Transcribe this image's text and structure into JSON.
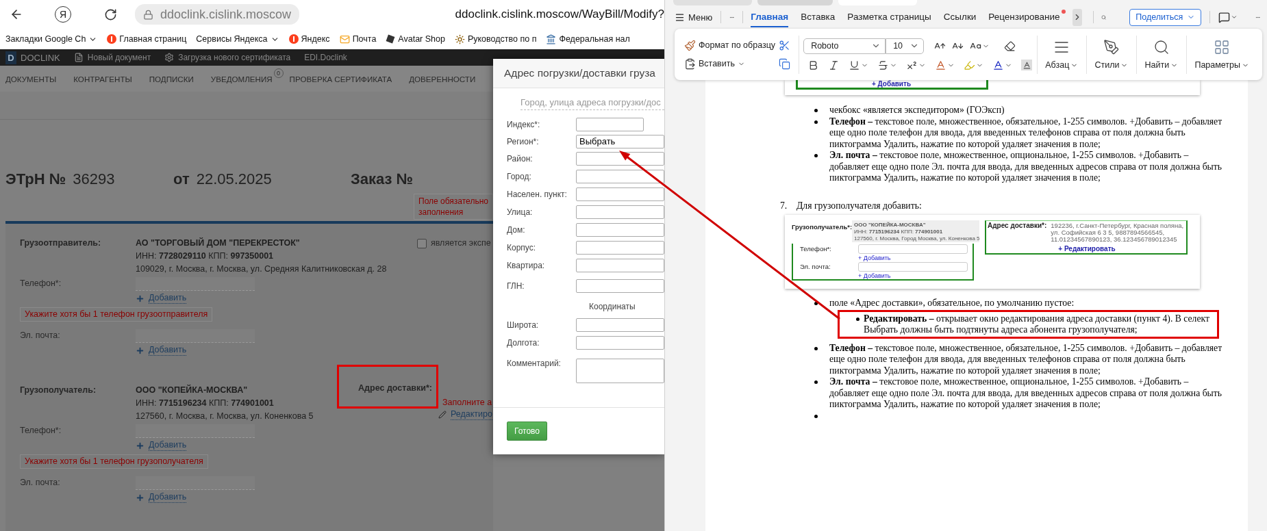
{
  "browser": {
    "home_glyph": "Я",
    "address": "ddoclink.cislink.moscow",
    "page_title": "ddoclink.cislink.moscow/WayBill/Modify?",
    "bookmarks": [
      {
        "kind": "folder",
        "label": "Закладки Google Ch"
      },
      {
        "kind": "yandex",
        "label": "Главная страниц"
      },
      {
        "kind": "folder",
        "label": "Сервисы Яндекса"
      },
      {
        "kind": "yandex",
        "label": "Яндекс"
      },
      {
        "kind": "mail",
        "label": "Почта"
      },
      {
        "kind": "shop",
        "label": "Avatar Shop"
      },
      {
        "kind": "guide",
        "label": "Руководство по п"
      },
      {
        "kind": "tax",
        "label": "Федеральная нал"
      }
    ]
  },
  "app": {
    "logo_letter": "D",
    "brand": "DOCLINK",
    "toolbar": [
      {
        "kind": "document",
        "label": "Новый документ"
      },
      {
        "kind": "gear",
        "label": "Загрузка нового сертификата"
      },
      {
        "kind": "plain",
        "label": "EDI.Doclink"
      }
    ],
    "nav": [
      {
        "label": "ДОКУМЕНТЫ"
      },
      {
        "label": "КОНТРАГЕНТЫ"
      },
      {
        "label": "ПОДПИСКИ"
      },
      {
        "label": "УВЕДОМЛЕНИЯ",
        "badge": "0"
      },
      {
        "label": "ПРОВЕРКА СЕРТИФИКАТА"
      },
      {
        "label": "ДОВЕРЕННОСТИ"
      }
    ]
  },
  "waybill": {
    "number_label": "ЭТрН №",
    "number": "36293",
    "date_label": "от",
    "date": "22.05.2025",
    "order_label": "Заказ №",
    "order_error": "Поле обязательно",
    "order_error_2": "заполнения"
  },
  "parties": [
    {
      "label": "Грузоотправитель:",
      "name": "АО \"ТОРГОВЫЙ ДОМ \"ПЕРЕКРЕСТОК\"",
      "details": "ИНН: **7728029110** КПП: **997350001**",
      "address": "109029, г. Москва, г. Москва, ул. Средняя Калитниковская д. 28",
      "side": {
        "kind": "checkbox",
        "label": "является экспе",
        "checked": false
      },
      "contacts": [
        {
          "label": "Телефон*:",
          "add": "Добавить",
          "error": "Укажите хотя бы 1 телефон грузоотправителя"
        },
        {
          "label": "Эл. почта:",
          "add": "Добавить"
        }
      ]
    },
    {
      "label": "Грузополучатель:",
      "name": "ООО \"КОПЕЙКА-МОСКВА\"",
      "details": "ИНН: **7715196234** КПП: **774901001**",
      "address": "127560, г. Москва, г. Москва, ул. Коненкова 5",
      "side": {
        "kind": "address",
        "label": "Адрес доставки*:",
        "highlighted": true,
        "error": "Заполните а",
        "link": "Редактиро"
      },
      "contacts": [
        {
          "label": "Телефон*:",
          "add": "Добавить",
          "error": "Укажите хотя бы 1 телефон грузополучателя"
        },
        {
          "label": "Эл. почта:",
          "add": "Добавить"
        }
      ]
    }
  ],
  "modal": {
    "title": "Адрес погрузки/доставки груза",
    "search_placeholder": "Город, улица адреса погрузки/дос",
    "fields": [
      {
        "kind": "short",
        "label": "Индекс*:"
      },
      {
        "kind": "select",
        "label": "Регион*:",
        "value": "Выбрать"
      },
      {
        "kind": "input",
        "label": "Район:"
      },
      {
        "kind": "input",
        "label": "Город:"
      },
      {
        "kind": "input",
        "label": "Населен. пункт:"
      },
      {
        "kind": "input",
        "label": "Улица:"
      },
      {
        "kind": "input",
        "label": "Дом:"
      },
      {
        "kind": "input",
        "label": "Корпус:"
      },
      {
        "kind": "input",
        "label": "Квартира:"
      },
      {
        "kind": "spaced",
        "label": "ГЛН:"
      },
      {
        "kind": "heading",
        "label": "Координаты"
      },
      {
        "kind": "input",
        "label": "Широта:"
      },
      {
        "kind": "input",
        "label": "Долгота:"
      },
      {
        "kind": "textarea",
        "label": "Комментарий:"
      }
    ],
    "button": "Готово"
  },
  "editor": {
    "menu": "Меню",
    "tabs": [
      {
        "label": "Главная",
        "selected": true,
        "notification": false
      },
      {
        "label": "Вставка",
        "selected": false,
        "notification": false
      },
      {
        "label": "Разметка страницы",
        "selected": false,
        "notification": false
      },
      {
        "label": "Ссылки",
        "selected": false,
        "notification": false
      },
      {
        "label": "Рецензирование",
        "selected": false,
        "notification": true
      }
    ],
    "share": "Поделиться",
    "ribbon": {
      "format_painter": "Формат по образцу",
      "paste": "Вставить",
      "font": "Roboto",
      "size": "10",
      "groups": [
        {
          "kind": "paragraph",
          "label": "Абзац"
        },
        {
          "kind": "styles",
          "label": "Стили"
        },
        {
          "kind": "find",
          "label": "Найти"
        },
        {
          "kind": "options",
          "label": "Параметры"
        }
      ]
    }
  },
  "document": {
    "top_figure": {
      "add": "+ Добавить"
    },
    "blocks": [
      {
        "kind": "bullet",
        "text": "чекбокс «является экспедитором» (ГОЭксп)"
      },
      {
        "kind": "bullet",
        "text": "**Телефон –** текстовое поле, множественное, обязательное, 1-255 символов. +Добавить – добавляет еще одно поле телефон для ввода, для введенных телефонов справа от поля должна быть пиктограмма Удалить, нажатие по которой удаляет значения в поле;"
      },
      {
        "kind": "bullet",
        "text": "**Эл. почта –** текстовое поле, множественное, опциональное, 1-255 символов. +Добавить – добавляет еще одно поле Эл. почта для ввода, для введенных адресов справа от поля должна быть пиктограмма Удалить, нажатие по которой удаляет значения в поле;"
      },
      {
        "kind": "numbered",
        "number": "7.",
        "text": "Для грузополучателя добавить:"
      },
      {
        "kind": "figure",
        "recipient_label": "Грузополучатель*:",
        "recipient_name": "ООО \"КОПЕЙКА-МОСКВА\"",
        "recipient_details": "ИНН: **7715196234** КПП: **774901001**",
        "recipient_address": "127560, г. Москва, Город Москва, ул. Коненкова 5",
        "contacts": [
          {
            "label": "Телефон*:",
            "add": "+ Добавить"
          },
          {
            "label": "Эл. почта:",
            "add": "+ Добавить"
          }
        ],
        "address_label": "Адрес доставки*:",
        "address_value": "192236, г.Санкт-Петербург, Красная поляна, ул. Софийская 6 3 5, 9887894566545, 11.01234567890123, 36.123456789012345",
        "edit_link": "+ Редактировать"
      },
      {
        "kind": "bullet",
        "text": "поле «Адрес доставки», обязательное, по умолчанию пустое:",
        "children": [
          {
            "text": "**Редактировать –** открывает окно редактирования адреса доставки (пункт 4). В селект Выбрать должны быть подтянуты адреса абонента грузополучателя;",
            "highlighted": true
          }
        ]
      },
      {
        "kind": "bullet",
        "text": "**Телефон –** текстовое поле, множественное, обязательное, 1-255 символов. +Добавить – добавляет еще одно поле телефон для ввода, для введенных телефонов справа от поля должна быть пиктограмма Удалить, нажатие по которой удаляет значения в поле;"
      },
      {
        "kind": "bullet",
        "text": "**Эл. почта –** текстовое поле, множественное, опциональное, 1-255 символов. +Добавить – добавляет еще одно поле Эл. почта для ввода, для введенных адресов справа от поля должна быть пиктограмма Удалить, нажатие по которой удаляет значения в поле;"
      },
      {
        "kind": "empty"
      }
    ]
  }
}
